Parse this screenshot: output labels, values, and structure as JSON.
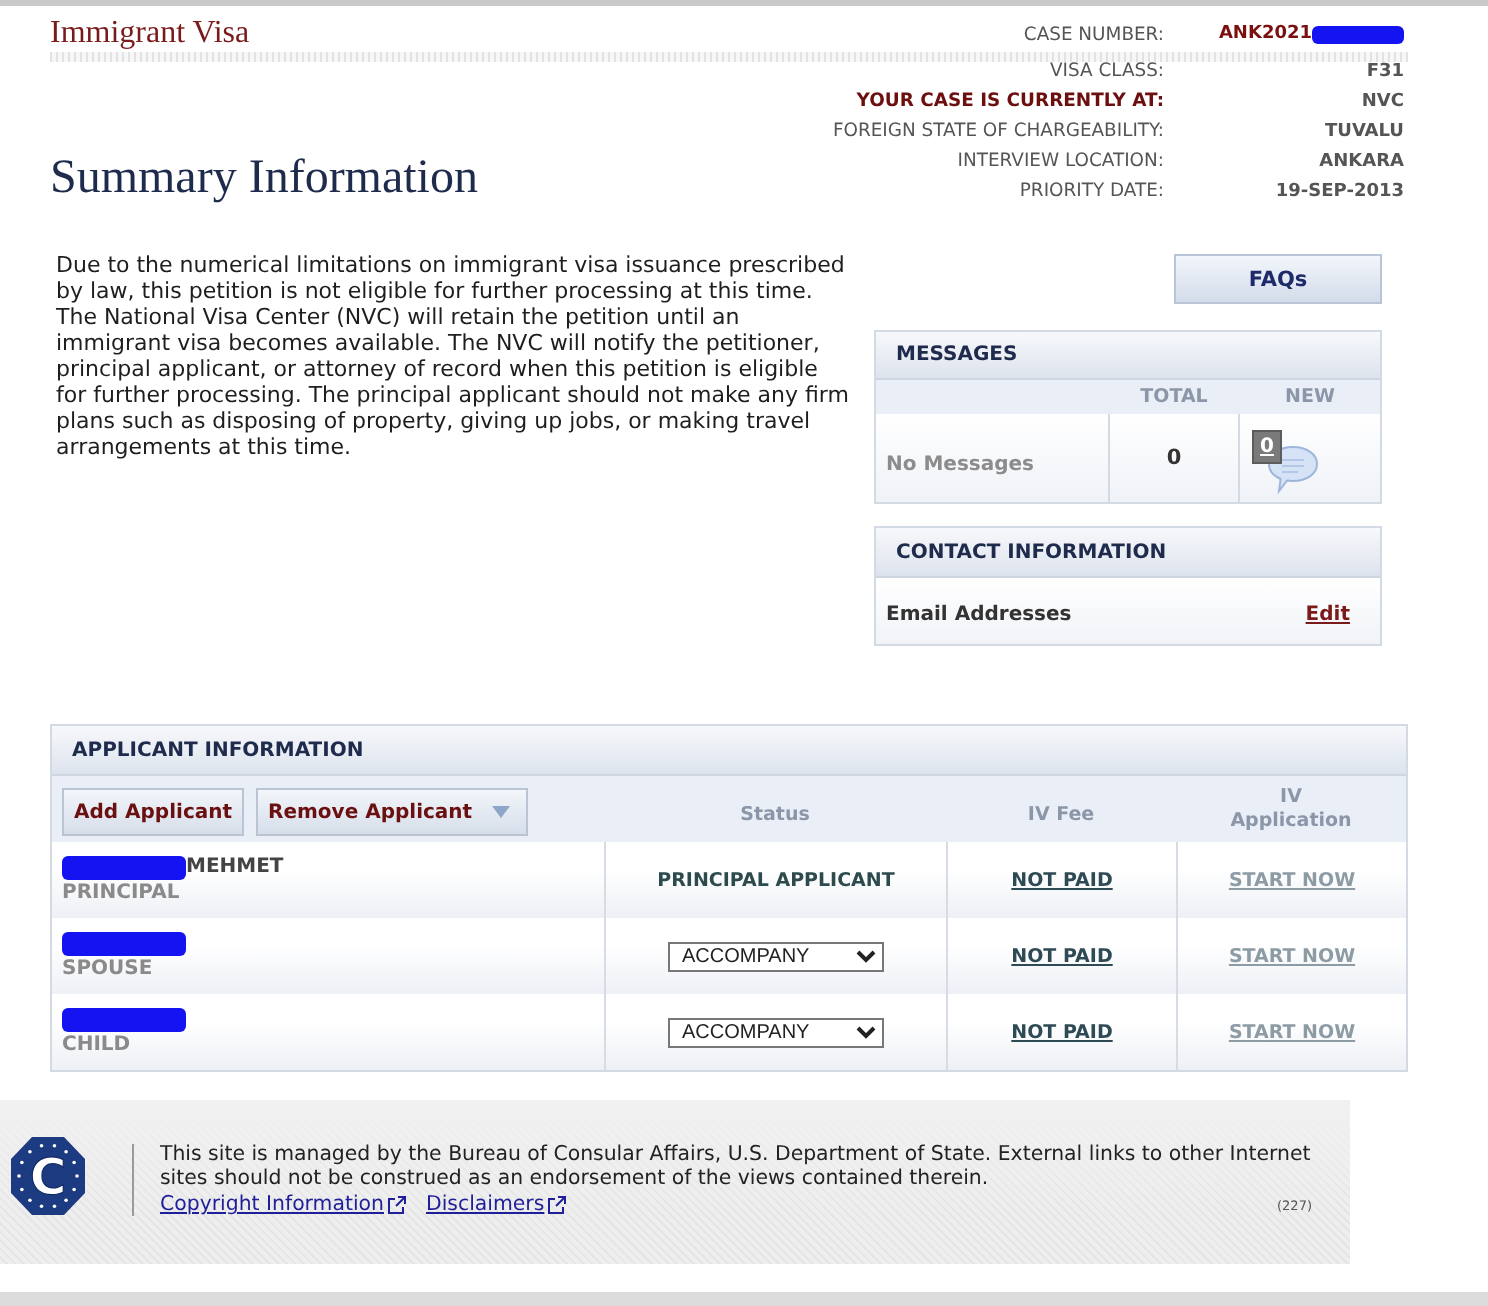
{
  "header": {
    "title": "Immigrant Visa"
  },
  "case_details": [
    {
      "label": "CASE NUMBER:",
      "value": "ANK2021",
      "kind": "highlight_value",
      "redacted": true
    },
    {
      "label": "VISA CLASS:",
      "value": "F31",
      "kind": "plain",
      "redacted": false
    },
    {
      "label": "YOUR CASE IS CURRENTLY AT:",
      "value": "NVC",
      "kind": "highlight_label",
      "redacted": false
    },
    {
      "label": "FOREIGN STATE OF CHARGEABILITY:",
      "value": "TUVALU",
      "kind": "plain",
      "redacted": false
    },
    {
      "label": "INTERVIEW LOCATION:",
      "value": "ANKARA",
      "kind": "plain",
      "redacted": false
    },
    {
      "label": "PRIORITY DATE:",
      "value": "19-SEP-2013",
      "kind": "plain",
      "redacted": false
    }
  ],
  "page_title": "Summary Information",
  "notice": "Due to the numerical limitations on immigrant visa issuance prescribed by law, this petition is not eligible for further processing at this time. The National Visa Center (NVC) will retain the petition until an immigrant visa becomes available. The NVC will notify the petitioner, principal applicant, or attorney of record when this petition is eligible for further processing. The principal applicant should not make any firm plans such as disposing of property, giving up jobs, or making travel arrangements at this time.",
  "faq_button": "FAQs",
  "messages": {
    "title": "MESSAGES",
    "columns": [
      "TOTAL",
      "NEW"
    ],
    "label": "No Messages",
    "total": "0",
    "new": "0"
  },
  "contact": {
    "title": "CONTACT INFORMATION",
    "label": "Email Addresses",
    "action": "Edit"
  },
  "applicants": {
    "title": "APPLICANT INFORMATION",
    "buttons": [
      {
        "label": "Add Applicant",
        "kind": "plain"
      },
      {
        "label": "Remove Applicant",
        "kind": "dropdown"
      }
    ],
    "columns": [
      "Status",
      "IV Fee",
      "IV Application"
    ],
    "rows": [
      {
        "name": "MEHMET",
        "redacted": true,
        "role": "PRINCIPAL",
        "status": {
          "kind": "text",
          "value": "PRINCIPAL APPLICANT"
        },
        "iv_fee": "NOT PAID",
        "iv_application": {
          "label": "START NOW",
          "disabled": true
        }
      },
      {
        "redacted": true,
        "role": "SPOUSE",
        "status": {
          "kind": "select",
          "value": "ACCOMPANY"
        },
        "iv_fee": "NOT PAID",
        "iv_application": {
          "label": "START NOW",
          "disabled": true
        }
      },
      {
        "redacted": true,
        "role": "CHILD",
        "status": {
          "kind": "select",
          "value": "ACCOMPANY"
        },
        "iv_fee": "NOT PAID",
        "iv_application": {
          "label": "START NOW",
          "disabled": true
        }
      }
    ]
  },
  "footer": {
    "logo_letter": "C",
    "text": "This site is managed by the Bureau of Consular Affairs, U.S. Department of State. External links to other Internet sites should not be construed as an endorsement of the views contained therein.",
    "links": [
      "Copyright Information",
      "Disclaimers"
    ],
    "code": "(227)"
  }
}
